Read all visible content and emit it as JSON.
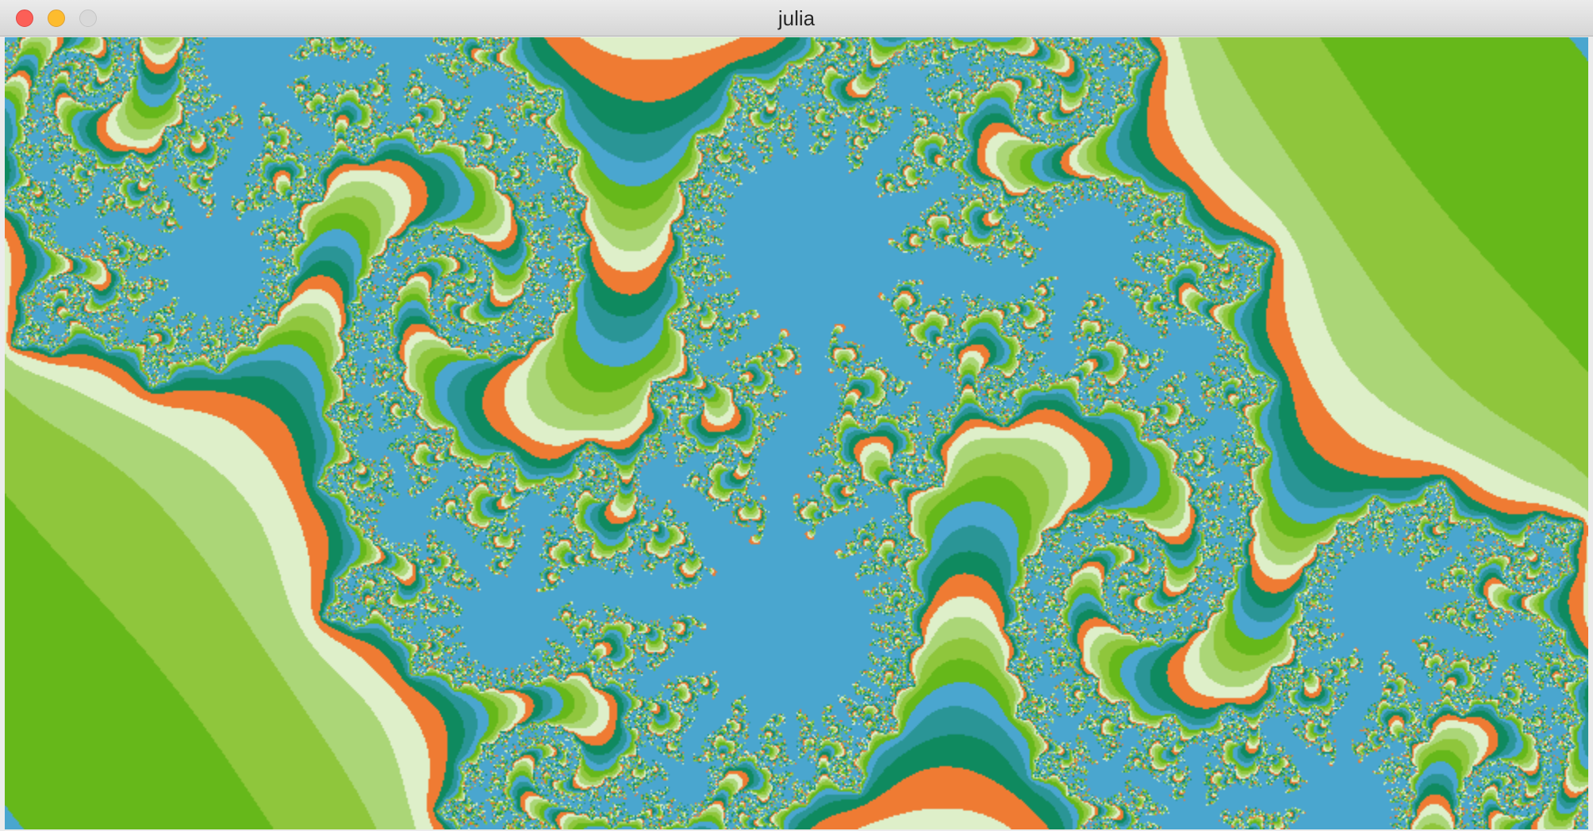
{
  "window": {
    "title": "julia"
  },
  "controls": {
    "close_icon": "close-icon",
    "minimize_icon": "minimize-icon",
    "zoom_icon": "zoom-icon"
  },
  "render": {
    "type": "julia-set",
    "palette": [
      "#0f8a5f",
      "#2a9596",
      "#4aa6cf",
      "#66b81a",
      "#8fc63c",
      "#abd677",
      "#deefc9",
      "#ef7b33"
    ]
  }
}
